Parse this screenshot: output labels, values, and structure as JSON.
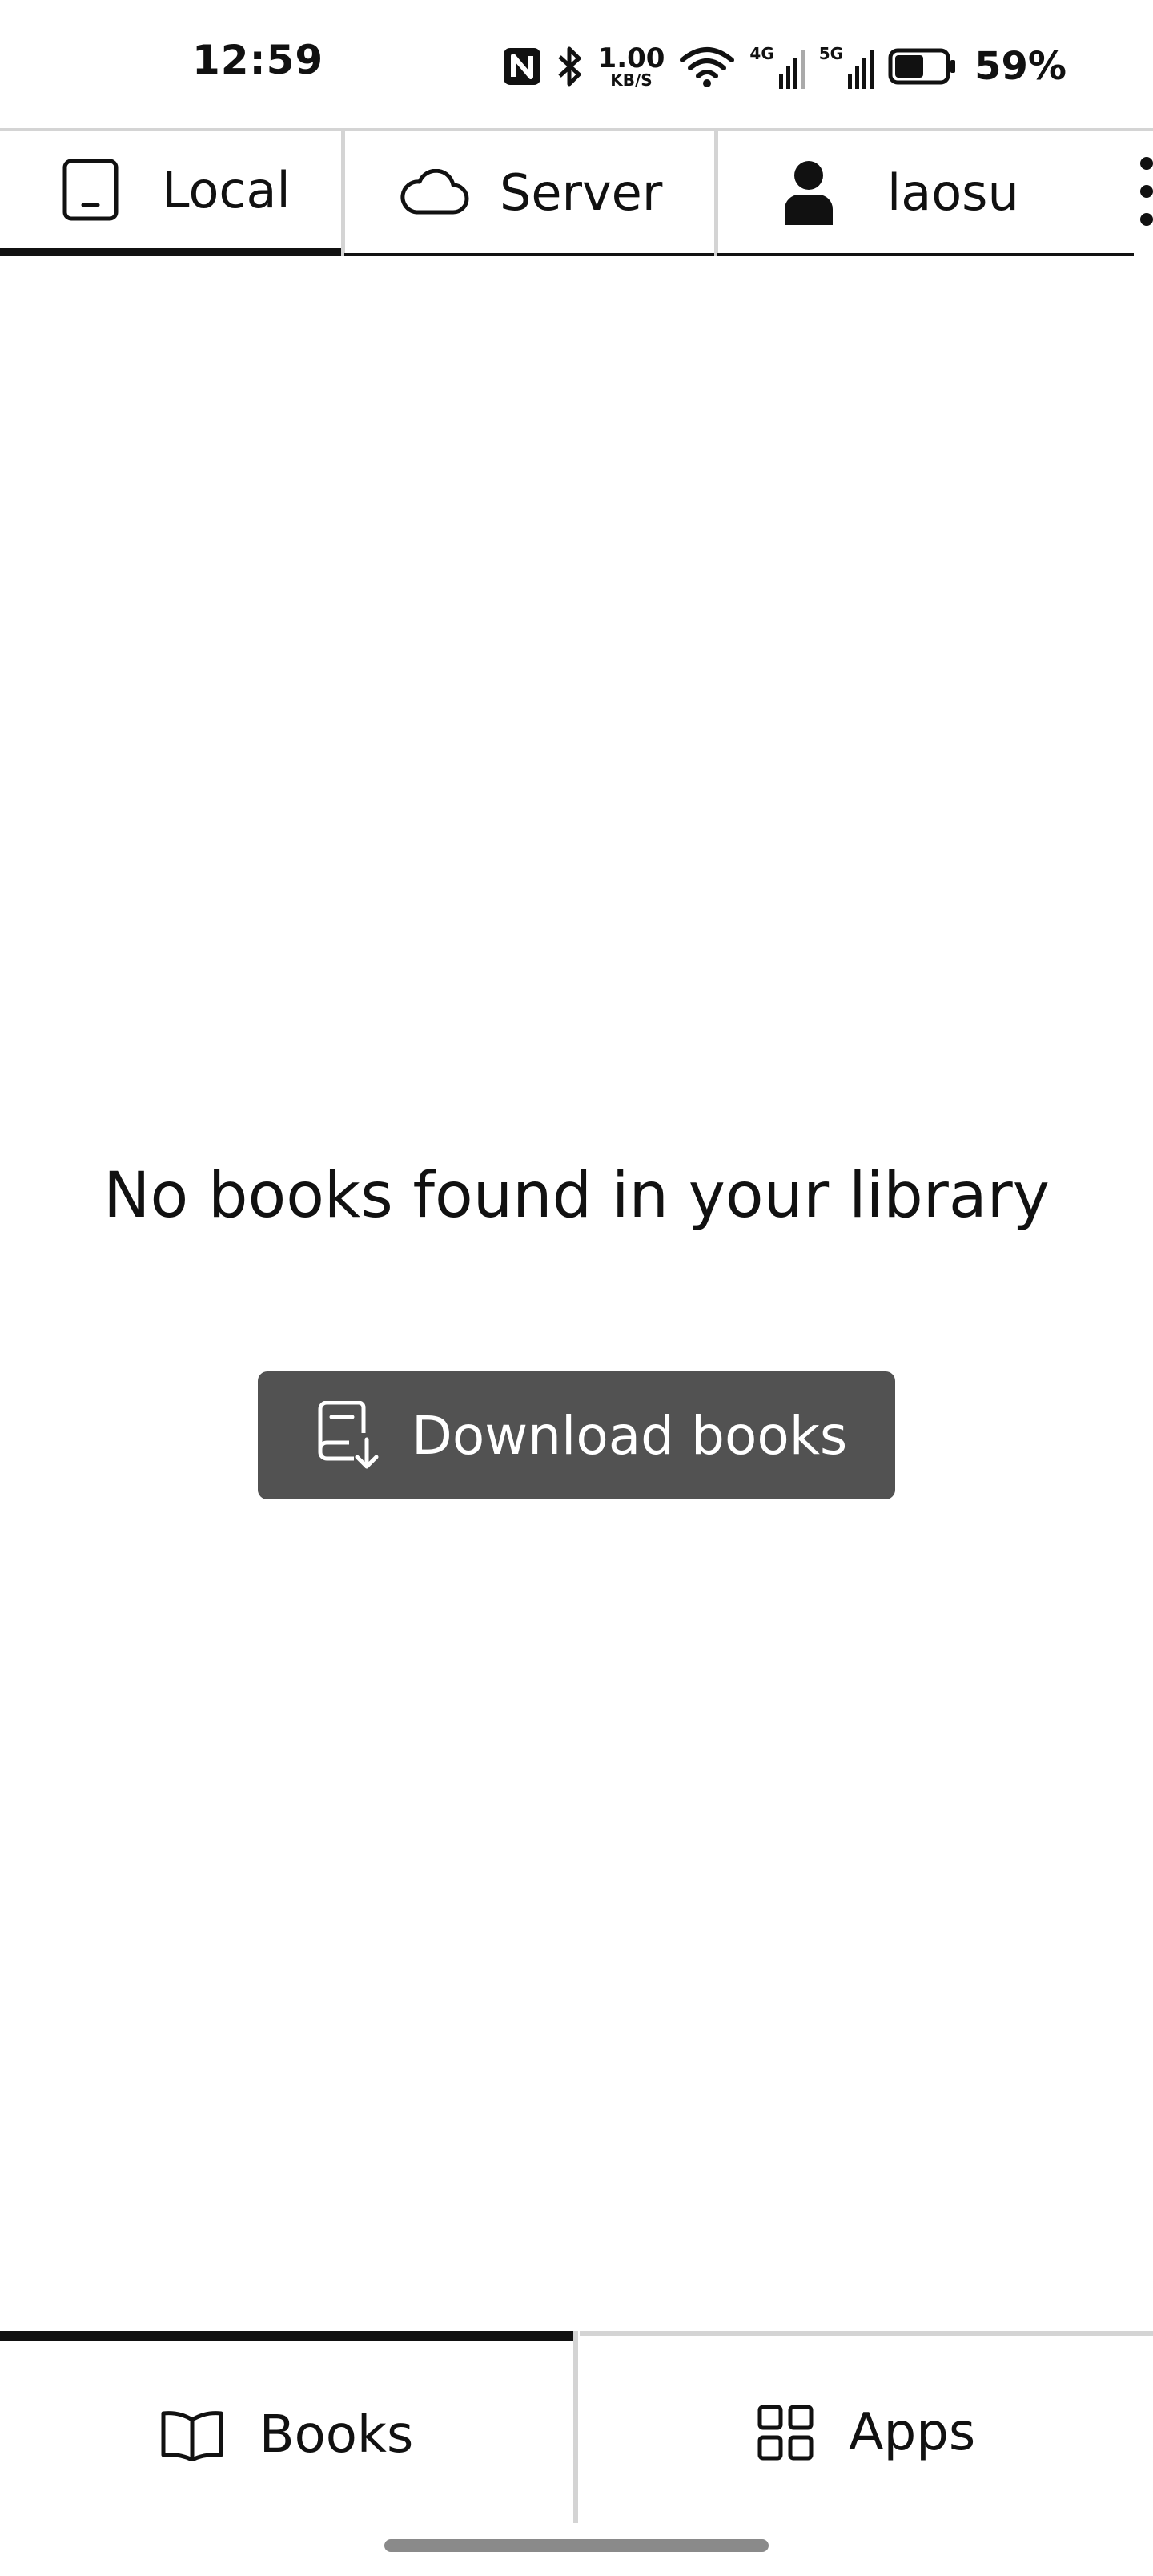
{
  "status_bar": {
    "time": "12:59",
    "net_speed_value": "1.00",
    "net_speed_unit": "KB/S",
    "signal_4g": "4G",
    "signal_5g": "5G",
    "battery_percent": "59%",
    "battery_level": 0.59
  },
  "top_tabs": [
    {
      "label": "Local",
      "icon": "tablet-icon",
      "active": true
    },
    {
      "label": "Server",
      "icon": "cloud-icon",
      "active": false
    },
    {
      "label": "laosu",
      "icon": "user-icon",
      "active": false
    }
  ],
  "main": {
    "empty_message": "No books found in your library",
    "download_button_label": "Download books"
  },
  "bottom_nav": [
    {
      "label": "Books",
      "icon": "open-book-icon",
      "active": true
    },
    {
      "label": "Apps",
      "icon": "apps-grid-icon",
      "active": false
    }
  ],
  "colors": {
    "button_bg": "#525252",
    "active_indicator": "#111111",
    "divider": "#d4d4d4"
  }
}
